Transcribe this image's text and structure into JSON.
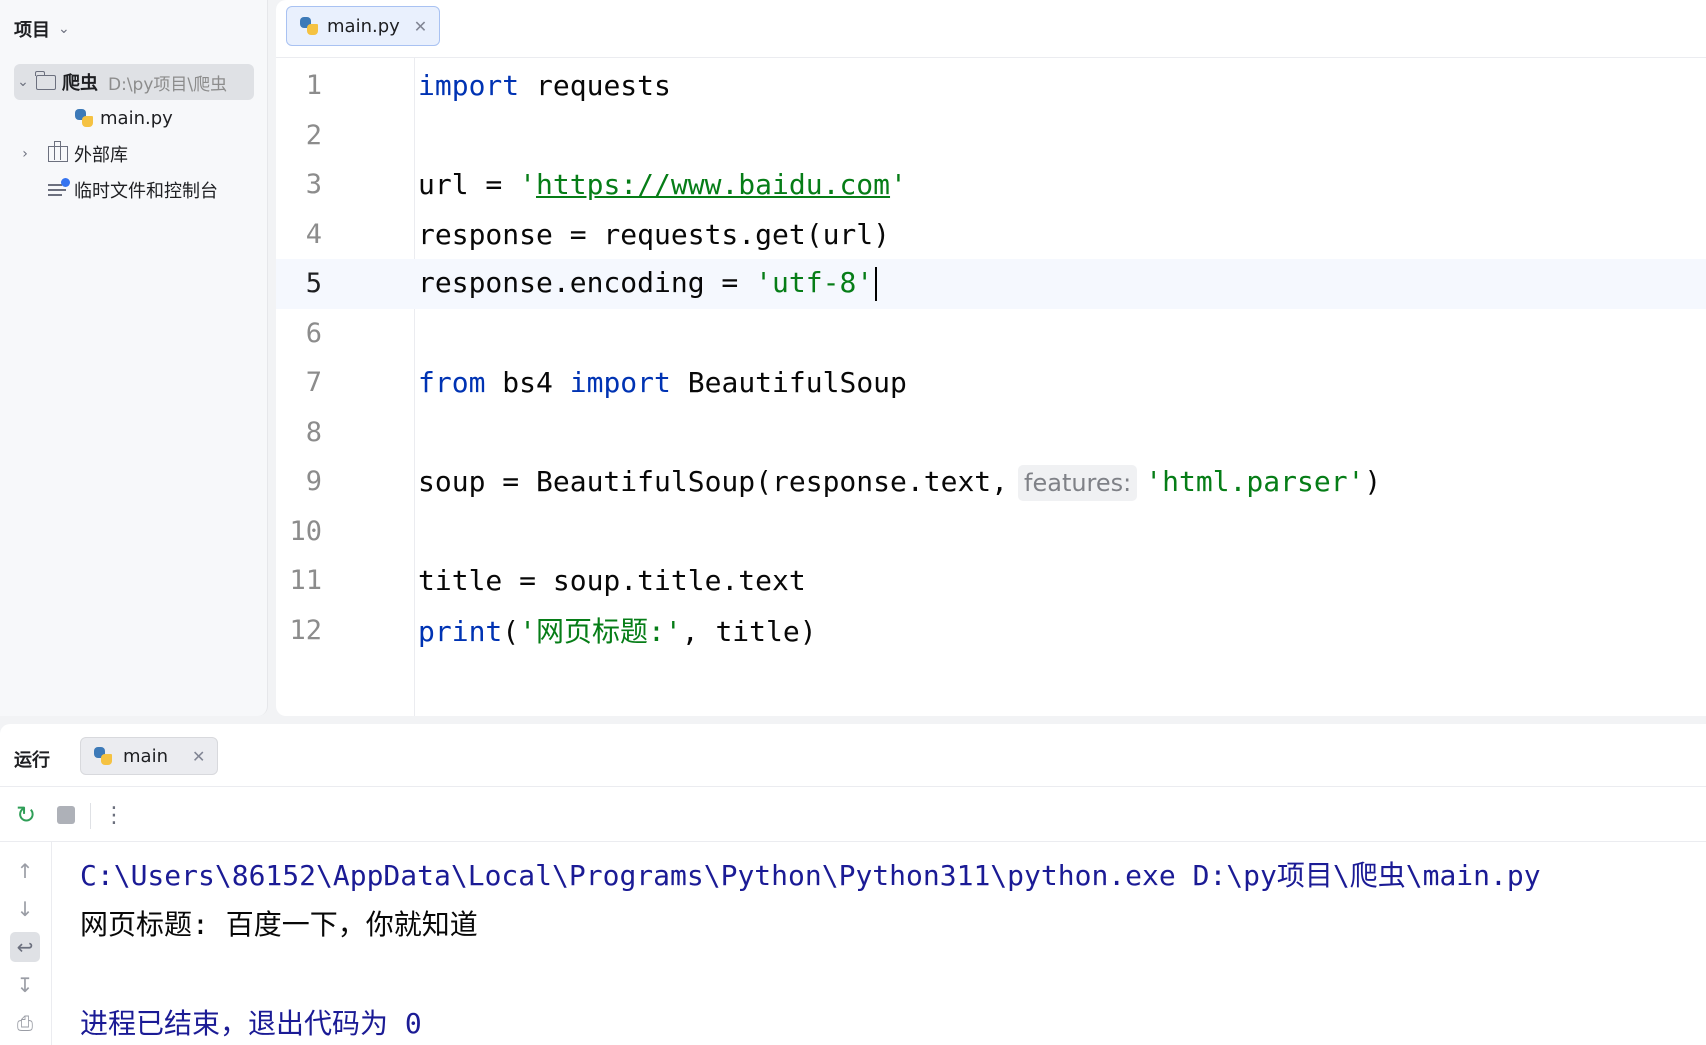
{
  "project_panel": {
    "title": "项目",
    "root": {
      "name": "爬虫",
      "path": "D:\\py项目\\爬虫"
    },
    "file": "main.py",
    "external_libs": "外部库",
    "scratches": "临时文件和控制台"
  },
  "editor": {
    "tab_label": "main.py",
    "current_line": 5,
    "lines": [
      {
        "n": "1"
      },
      {
        "n": "2"
      },
      {
        "n": "3"
      },
      {
        "n": "4"
      },
      {
        "n": "5"
      },
      {
        "n": "6"
      },
      {
        "n": "7"
      },
      {
        "n": "8"
      },
      {
        "n": "9"
      },
      {
        "n": "10"
      },
      {
        "n": "11"
      },
      {
        "n": "12"
      }
    ],
    "code": {
      "l1_kw": "import",
      "l1_rest": " requests",
      "l3_a": "url = ",
      "l3_q1": "'",
      "l3_url": "https://www.baidu.com",
      "l3_q2": "'",
      "l4": "response = requests.get(url)",
      "l5_a": "response.encoding = ",
      "l5_str": "'utf-8'",
      "l7_kw1": "from",
      "l7_mid": " bs4 ",
      "l7_kw2": "import",
      "l7_rest": " BeautifulSoup",
      "l9_a": "soup = BeautifulSoup(response.text,",
      "l9_hint": "features:",
      "l9_str": "'html.parser'",
      "l9_end": ")",
      "l11": "title = soup.title.text",
      "l12_kw": "print",
      "l12_a": "(",
      "l12_str": "'网页标题:'",
      "l12_rest": ", title)"
    }
  },
  "run_panel": {
    "title": "运行",
    "tab_label": "main",
    "console": [
      "C:\\Users\\86152\\AppData\\Local\\Programs\\Python\\Python311\\python.exe D:\\py项目\\爬虫\\main.py",
      "网页标题: 百度一下，你就知道",
      "",
      "进程已结束，退出代码为 0"
    ]
  },
  "icons": {
    "rerun": "rerun-icon",
    "stop": "stop-icon",
    "more": "more-icon",
    "scroll_up": "arrow-up-icon",
    "scroll_down": "arrow-down-icon",
    "soft_wrap": "soft-wrap-icon",
    "scroll_end": "scroll-to-end-icon",
    "print": "print-icon"
  },
  "colors": {
    "keyword": "#0033b3",
    "string": "#067d17",
    "console_system": "#1b1b95",
    "rerun": "#2f9e57"
  }
}
